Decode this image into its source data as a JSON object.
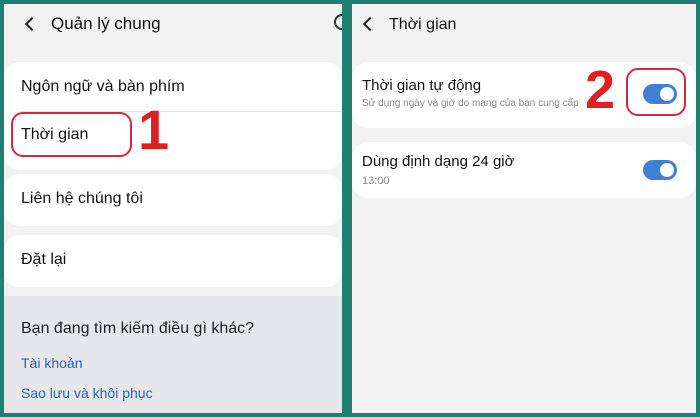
{
  "left_screen": {
    "title": "Quản lý chung",
    "items": [
      {
        "label": "Ngôn ngữ và bàn phím"
      },
      {
        "label": "Thời gian"
      },
      {
        "label": "Liên hệ chúng tôi"
      },
      {
        "label": "Đặt lại"
      }
    ],
    "search_prompt": "Bạn đang tìm kiếm điều gì khác?",
    "links": [
      "Tài khoản",
      "Sao lưu và khôi phục"
    ],
    "step_number": "1"
  },
  "right_screen": {
    "title": "Thời gian",
    "settings": [
      {
        "title": "Thời gian tự động",
        "subtitle": "Sử dụng ngày và giờ do mạng của bạn cung cấp",
        "enabled": true
      },
      {
        "title": "Dùng định dạng 24 giờ",
        "subtitle": "13:00",
        "enabled": true
      }
    ],
    "step_number": "2"
  },
  "colors": {
    "frame": "#1f7f73",
    "highlight": "#d9263a",
    "step_number": "#e02020",
    "toggle_on": "#3f7fd6",
    "link": "#2a63b8"
  }
}
